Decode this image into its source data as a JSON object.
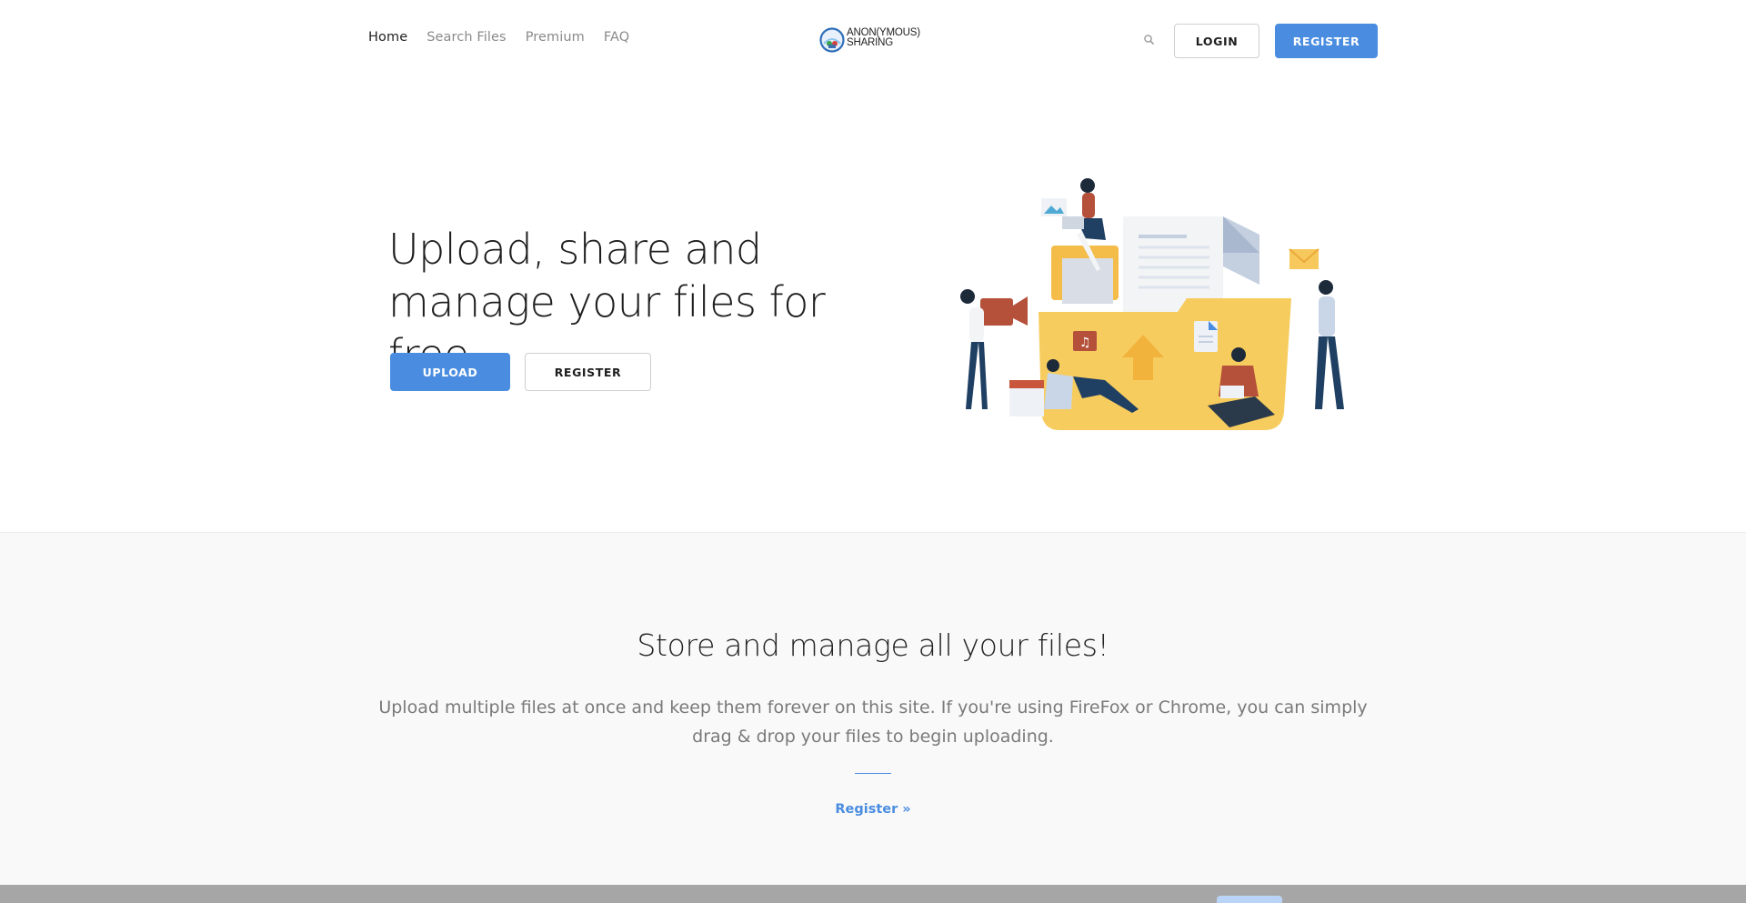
{
  "nav": {
    "items": [
      {
        "label": "Home",
        "active": true
      },
      {
        "label": "Search Files",
        "active": false
      },
      {
        "label": "Premium",
        "active": false
      },
      {
        "label": "FAQ",
        "active": false
      }
    ]
  },
  "logo": {
    "text": "ANON(YMOUS)\nSHARING",
    "icon": "globe-logo-icon"
  },
  "header": {
    "search_icon": "search-icon",
    "login_label": "LOGIN",
    "register_label": "REGISTER"
  },
  "hero": {
    "title": "Upload, share and manage your files for free.",
    "upload_label": "UPLOAD",
    "register_label": "REGISTER",
    "illustration": "file-sharing-illustration"
  },
  "feature": {
    "title": "Store and manage all your files!",
    "description": "Upload multiple files at once and keep them forever on this site. If you're using FireFox or Chrome, you can simply drag & drop your files to begin uploading.",
    "link_label": "Register »"
  },
  "colors": {
    "accent": "#4a8de0",
    "text_dark": "#222222",
    "text_muted": "#8a8a8a",
    "section_bg": "#f9f9f9",
    "folder_yellow": "#f7c95c"
  }
}
